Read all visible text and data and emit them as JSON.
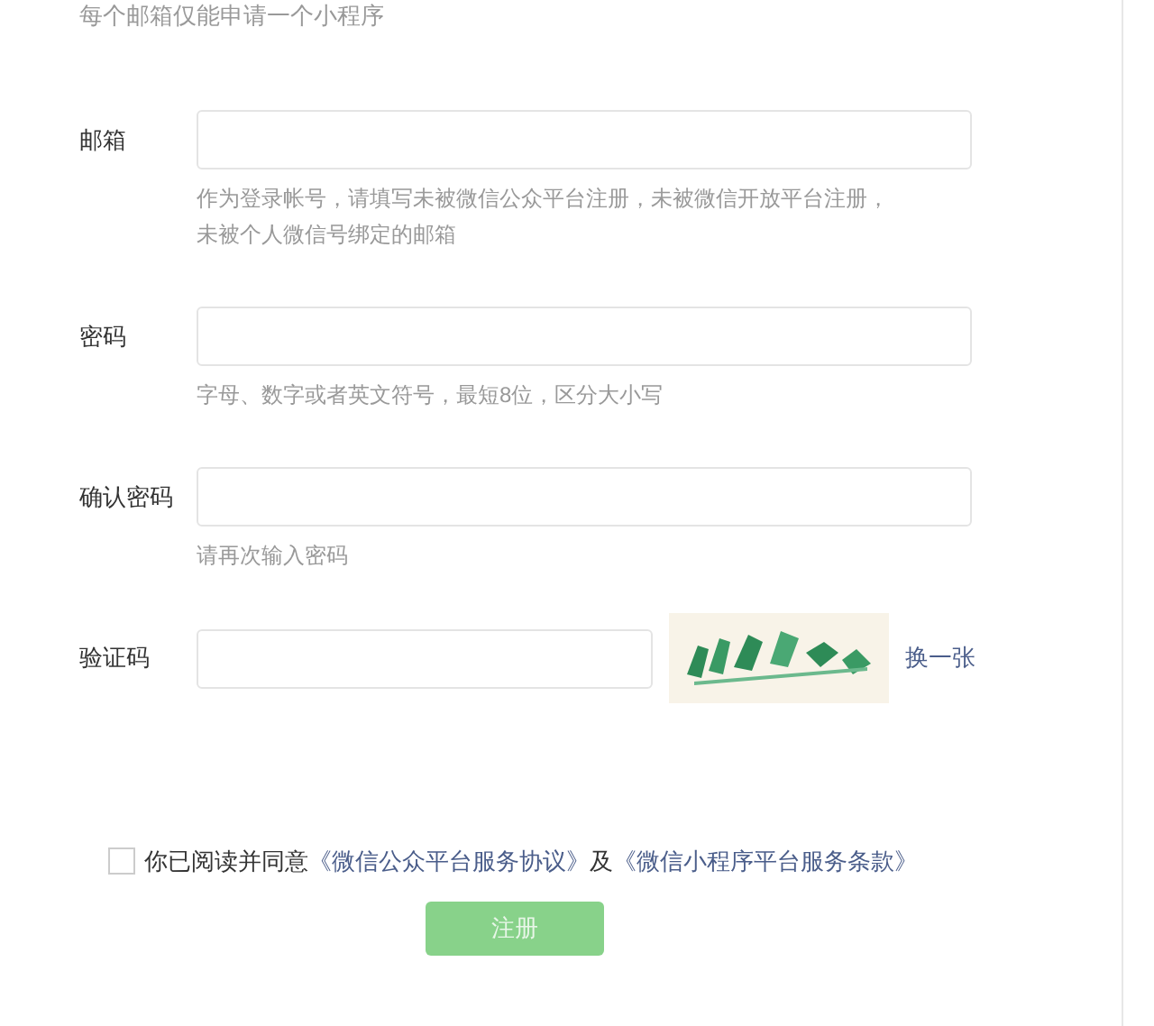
{
  "intro": "每个邮箱仅能申请一个小程序",
  "fields": [
    {
      "kind": "text",
      "label": "邮箱",
      "hint_lines": [
        "作为登录帐号，请填写未被微信公众平台注册，未被微信开放平台注册，",
        "未被个人微信号绑定的邮箱"
      ]
    },
    {
      "kind": "text",
      "label": "密码",
      "hint_lines": [
        "字母、数字或者英文符号，最短8位，区分大小写"
      ]
    },
    {
      "kind": "text",
      "label": "确认密码",
      "hint_lines": [
        "请再次输入密码"
      ]
    },
    {
      "kind": "captcha",
      "label": "验证码",
      "refresh_link": "换一张"
    }
  ],
  "agreement": {
    "checked": false,
    "text": "你已阅读并同意",
    "link_1": "《微信公众平台服务协议》",
    "joiner": "及",
    "link_2": "《微信小程序平台服务条款》"
  },
  "submit": {
    "label": "注册",
    "disabled": true
  }
}
